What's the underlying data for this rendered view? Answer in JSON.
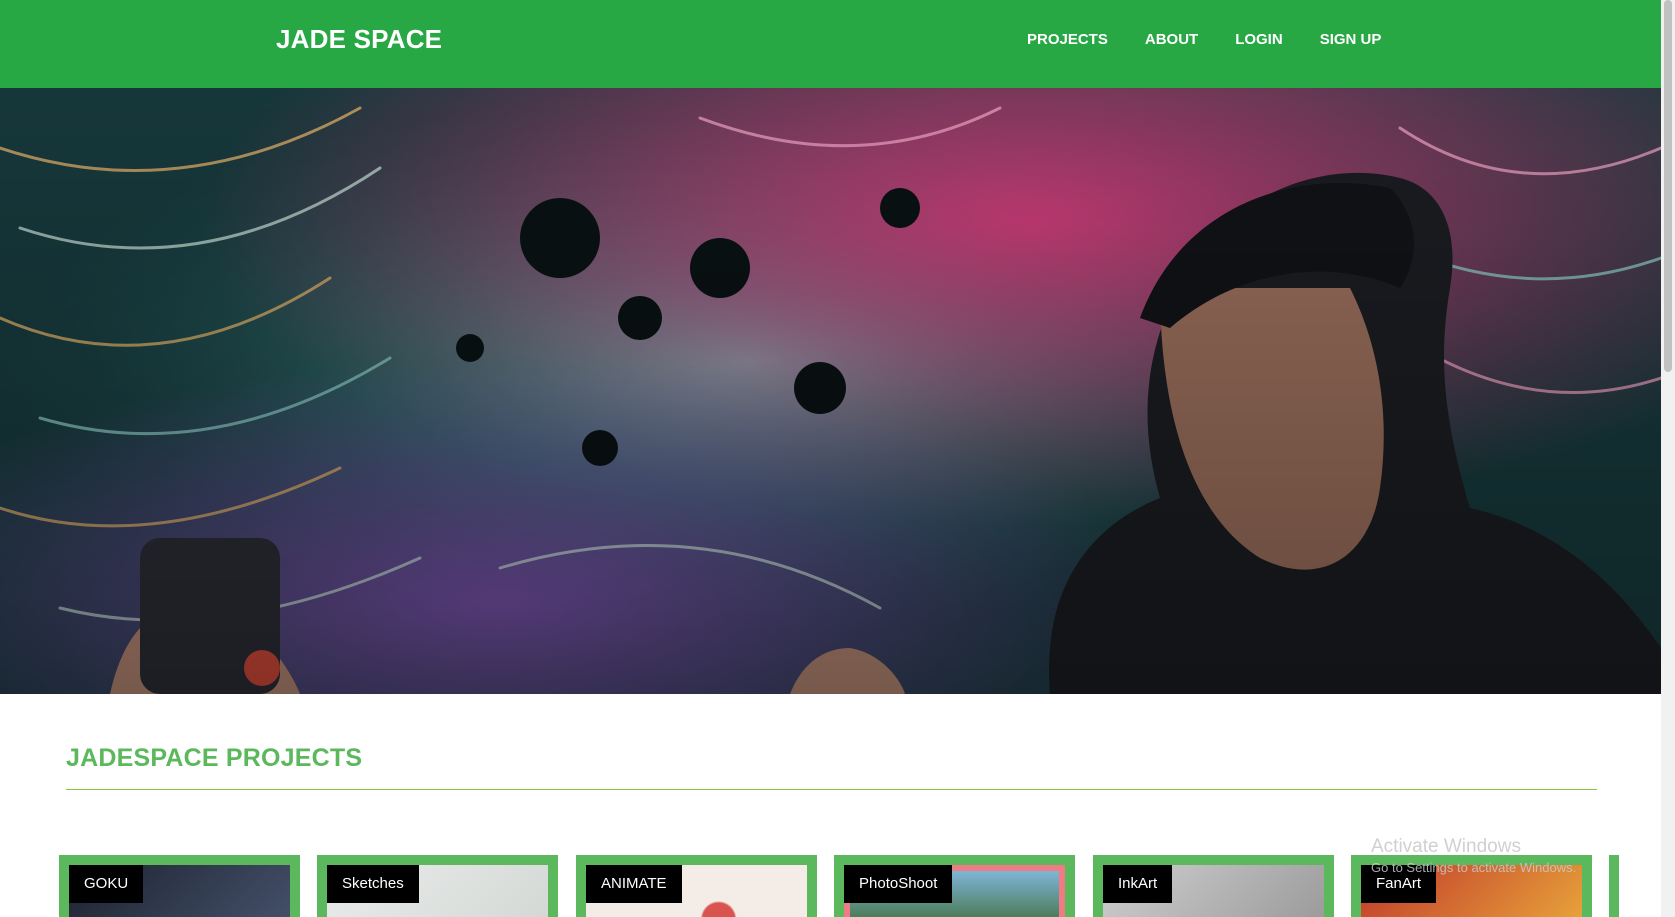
{
  "brand": "JADE SPACE",
  "nav": {
    "items": [
      "PROJECTS",
      "ABOUT",
      "LOGIN",
      "SIGN UP"
    ]
  },
  "colors": {
    "primary": "#28a745",
    "accent": "#5cb85c",
    "rule": "#8cc63f"
  },
  "hero": {
    "image": "artist-spray-painting-mural"
  },
  "section": {
    "title": "JADESPACE PROJECTS"
  },
  "projects": [
    {
      "label": "GOKU"
    },
    {
      "label": "Sketches"
    },
    {
      "label": "ANIMATE"
    },
    {
      "label": "PhotoShoot"
    },
    {
      "label": "InkArt"
    },
    {
      "label": "FanArt"
    }
  ],
  "watermark": {
    "title": "Activate Windows",
    "subtitle": "Go to Settings to activate Windows."
  }
}
